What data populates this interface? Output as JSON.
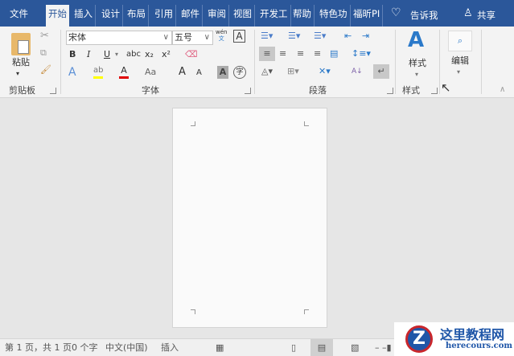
{
  "tabs": [
    "文件",
    "开始",
    "插入",
    "设计",
    "布局",
    "引用",
    "邮件",
    "审阅",
    "视图",
    "开发工",
    "帮助",
    "特色功",
    "福昕PI"
  ],
  "tell_me": "告诉我",
  "share": "共享",
  "clipboard": {
    "paste": "粘贴",
    "label": "剪贴板"
  },
  "font": {
    "name": "宋体",
    "size": "五号",
    "phonetic": "wén",
    "phonetic_char": "文",
    "border_char": "A",
    "bold": "B",
    "italic": "I",
    "underline": "U",
    "strike": "abc",
    "sub": "x₂",
    "sup": "x²",
    "text_effect": "A",
    "highlight": "ab",
    "font_color": "A",
    "change_case": "Aa",
    "grow": "A",
    "shrink": "A",
    "shade": "A",
    "enclose": "字",
    "label": "字体"
  },
  "paragraph": {
    "label": "段落",
    "sort": "A↓"
  },
  "styles": {
    "button": "样式",
    "label": "样式"
  },
  "editing": {
    "button": "编辑"
  },
  "status": {
    "page": "第 1 页，共 1 页",
    "words": "0 个字",
    "lang": "中文(中国)",
    "mode": "插入"
  },
  "watermark": {
    "cn": "这里教程网",
    "en": "herecours.com"
  },
  "colors": {
    "brand": "#2b579a",
    "highlight": "#ffff00",
    "font_color": "#e00000"
  }
}
